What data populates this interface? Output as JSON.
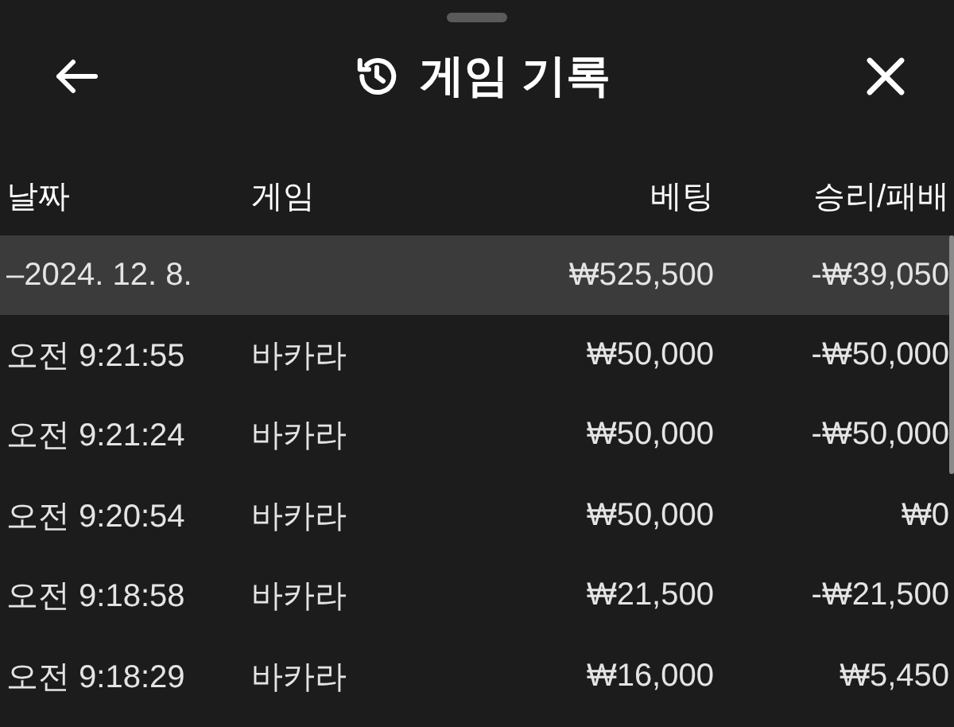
{
  "header": {
    "title": "게임 기록"
  },
  "table": {
    "columns": [
      "날짜",
      "게임",
      "베팅",
      "승리/패배"
    ],
    "group": {
      "date": "–2024. 12. 8.",
      "bet": "₩525,500",
      "result": "-₩39,050"
    },
    "rows": [
      {
        "time": "오전 9:21:55",
        "game": "바카라",
        "bet": "₩50,000",
        "result": "-₩50,000"
      },
      {
        "time": "오전 9:21:24",
        "game": "바카라",
        "bet": "₩50,000",
        "result": "-₩50,000"
      },
      {
        "time": "오전 9:20:54",
        "game": "바카라",
        "bet": "₩50,000",
        "result": "₩0"
      },
      {
        "time": "오전 9:18:58",
        "game": "바카라",
        "bet": "₩21,500",
        "result": "-₩21,500"
      },
      {
        "time": "오전 9:18:29",
        "game": "바카라",
        "bet": "₩16,000",
        "result": "₩5,450"
      }
    ]
  }
}
